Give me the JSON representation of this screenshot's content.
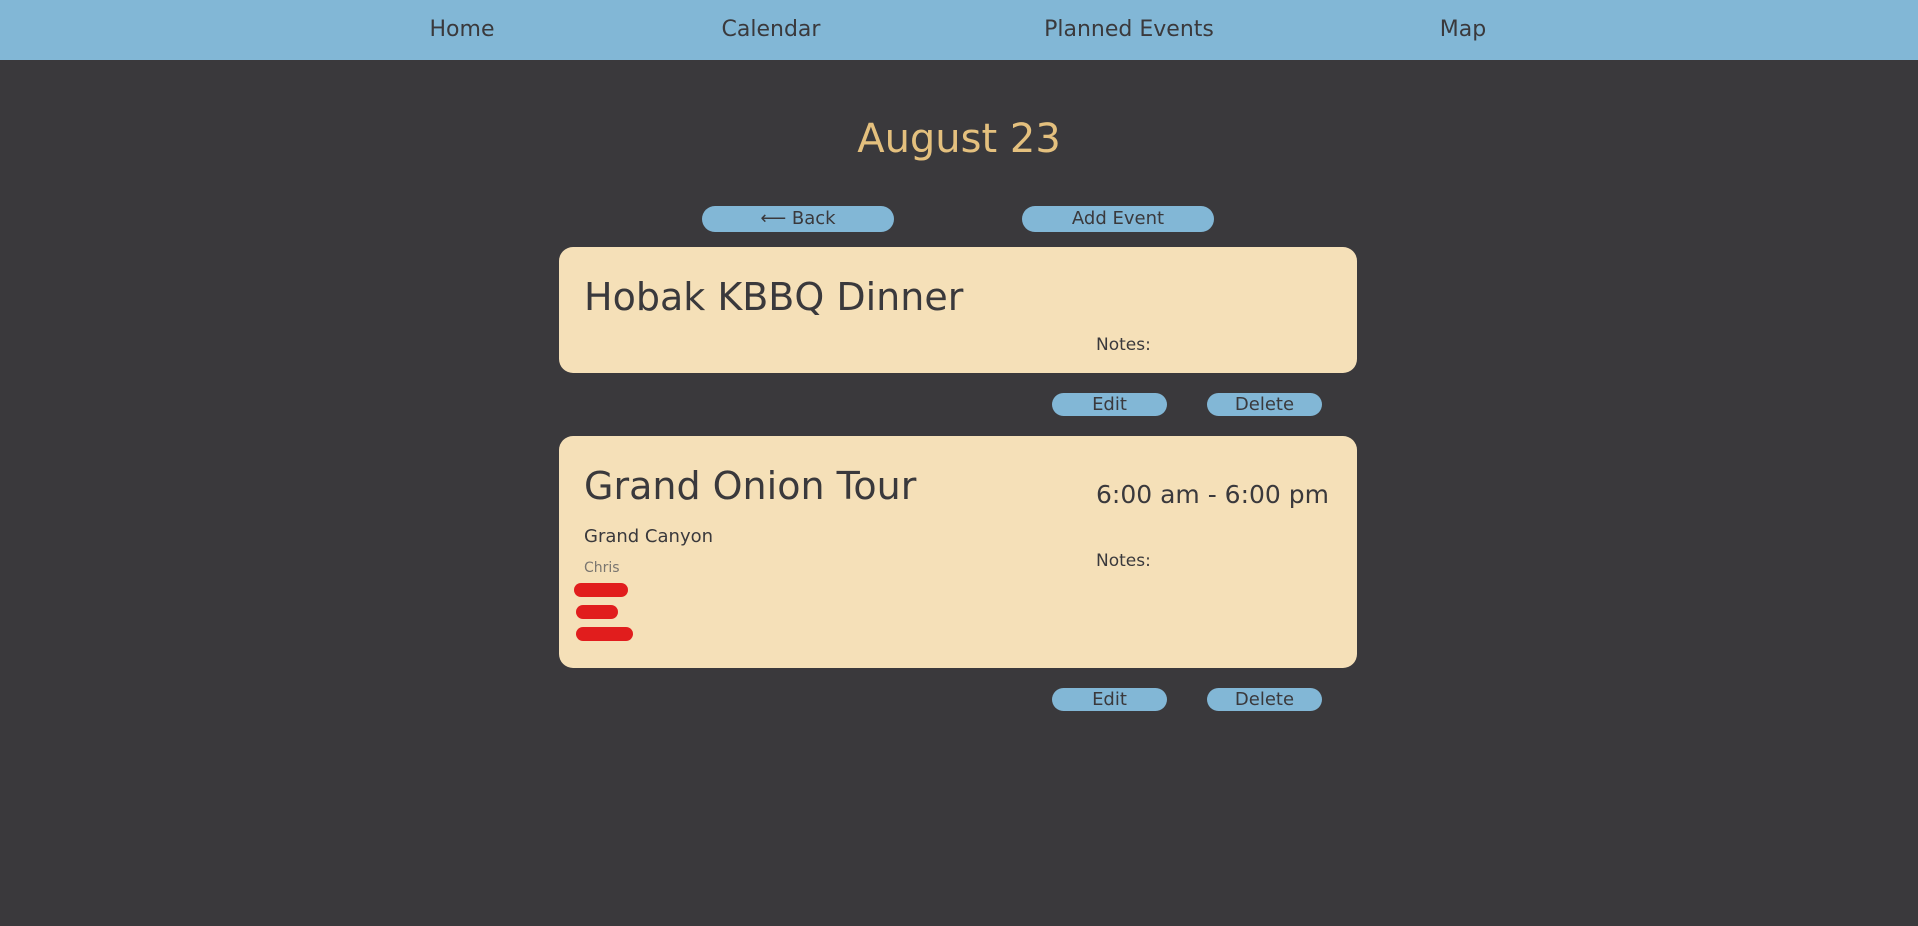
{
  "nav": {
    "items": [
      {
        "label": "Home"
      },
      {
        "label": "Calendar"
      },
      {
        "label": "Planned Events"
      },
      {
        "label": "Map"
      }
    ],
    "background": "#82b7d6"
  },
  "page": {
    "title": "August 23",
    "title_color": "#e4c07e",
    "background": "#3a393c"
  },
  "actions": {
    "back_label": "⟵ Back",
    "add_event_label": "Add Event"
  },
  "events": [
    {
      "title": "Hobak KBBQ Dinner",
      "notes_label": "Notes:",
      "edit_label": "Edit",
      "delete_label": "Delete"
    },
    {
      "title": "Grand Onion Tour",
      "time": "6:00 am - 6:00 pm",
      "location": "Grand Canyon",
      "person": "Chris",
      "notes_label": "Notes:",
      "edit_label": "Edit",
      "delete_label": "Delete",
      "avatar_color": "#e11d1d"
    }
  ],
  "colors": {
    "card": "#f5e0b8",
    "button": "#82b7d6",
    "text_dark": "#3a393c"
  }
}
